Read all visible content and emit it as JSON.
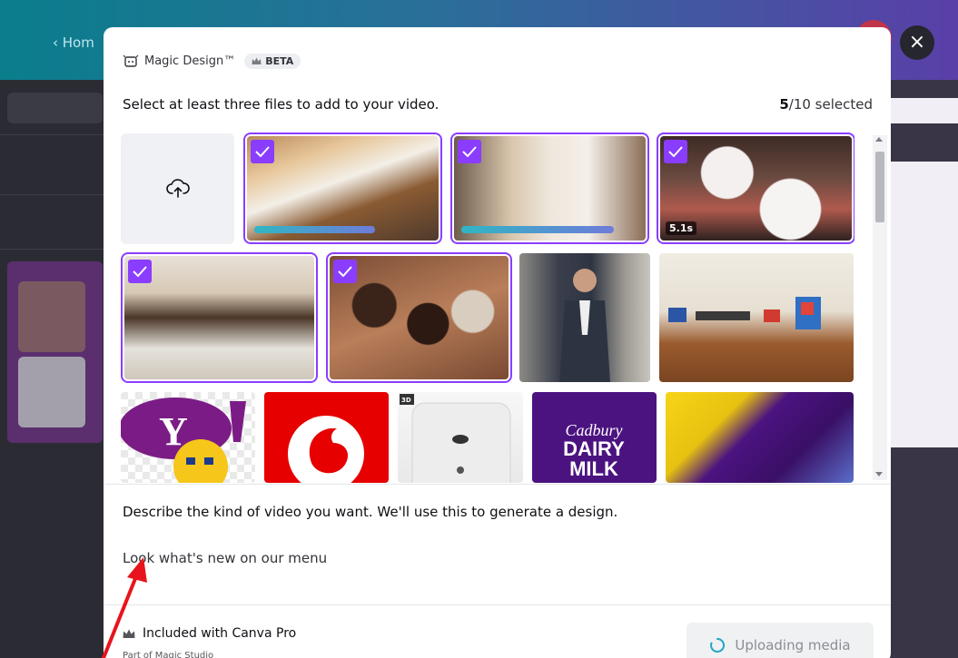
{
  "background": {
    "topbar_text": "‹  Hom",
    "sidebar_lines": [
      "",
      "",
      "",
      "",
      "",
      ""
    ]
  },
  "header": {
    "title": "Magic Design™",
    "beta": "BETA"
  },
  "instruction": "Select at least three files to add to your video.",
  "selection": {
    "selected": "5",
    "total_label": "/10 selected"
  },
  "media": [
    {
      "name": "pastries-platter",
      "selected": true,
      "progress": 0.68
    },
    {
      "name": "cake-and-dessert-cups",
      "selected": true,
      "progress": 0.86
    },
    {
      "name": "pomegranate-pavlovas",
      "selected": true,
      "duration": "5.1s"
    },
    {
      "name": "chia-pudding-glasses",
      "selected": true
    },
    {
      "name": "chocolate-desserts",
      "selected": true
    },
    {
      "name": "man-in-suit",
      "selected": false
    },
    {
      "name": "art-gallery-room",
      "selected": false
    },
    {
      "name": "yahoo-logo",
      "selected": false
    },
    {
      "name": "vodafone-logo",
      "selected": false
    },
    {
      "name": "white-phone",
      "selected": false,
      "badge": "3D"
    },
    {
      "name": "cadbury-dairy-milk-logo",
      "selected": false,
      "brand_text": [
        "Cadbury",
        "DAIRY",
        "MILK"
      ]
    },
    {
      "name": "dairy-milk-bars",
      "selected": false
    }
  ],
  "description": {
    "label": "Describe the kind of video you want. We'll use this to generate a design.",
    "value": "Look what's new on our menu"
  },
  "footer": {
    "included": "Included with Canva Pro",
    "part_of": "Part of Magic Studio",
    "upload_button": "Uploading media"
  },
  "colors": {
    "accent": "#8b3dff",
    "progress_start": "#2fb6c4",
    "progress_end": "#6f7bd9",
    "vodafone_red": "#e60000",
    "cadbury_purple": "#4b1380",
    "annotation_arrow": "#e8141b"
  },
  "icons": {
    "close": "close-icon",
    "upload": "cloud-upload-icon",
    "check": "check-icon",
    "crown": "crown-icon",
    "spinner": "loading-spinner-icon",
    "magic": "magic-design-icon"
  }
}
